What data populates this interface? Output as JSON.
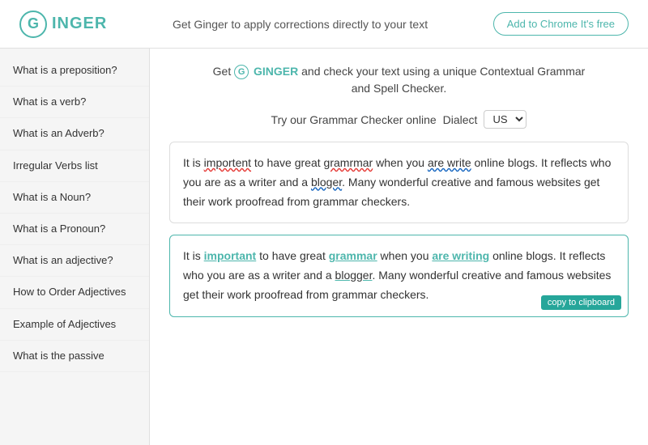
{
  "header": {
    "logo_g": "G",
    "logo_name": "INGER",
    "tagline": "Get Ginger to apply corrections directly to your text",
    "cta_button": "Add to Chrome It's free"
  },
  "sidebar": {
    "items": [
      {
        "label": "What is a preposition?"
      },
      {
        "label": "What is a verb?"
      },
      {
        "label": "What is an Adverb?"
      },
      {
        "label": "Irregular Verbs list"
      },
      {
        "label": "What is a Noun?"
      },
      {
        "label": "What is a Pronoun?"
      },
      {
        "label": "What is an adjective?"
      },
      {
        "label": "How to Order Adjectives"
      },
      {
        "label": "Example of Adjectives"
      },
      {
        "label": "What is the passive"
      }
    ]
  },
  "content": {
    "promo_text_1": "Get",
    "promo_brand": "GINGER",
    "promo_text_2": "and check your text using a unique Contextual Grammar",
    "promo_text_3": "and Spell Checker.",
    "grammar_checker_label": "Try our Grammar Checker online",
    "dialect_label": "Dialect",
    "dialect_value": "US",
    "original_box": {
      "text_pre": "It is ",
      "error1": "importent",
      "text_mid1": " to have great ",
      "error2": "gramrmar",
      "text_mid2": " when you ",
      "error3": "are write",
      "text_mid3": " online blogs. It reflects who you are as a writer and a ",
      "error4": "bloger",
      "text_end": ". Many wonderful creative and famous websites get their work proofread from grammar checkers."
    },
    "corrected_box": {
      "text_pre": "It is ",
      "word1": "important",
      "text_mid1": " to have great ",
      "word2": "grammar",
      "text_mid2": " when you ",
      "word3": "are writing",
      "text_mid3": " online blogs. It reflects who you are as a writer and a ",
      "word4": "blogger",
      "text_end": ". Many wonderful creative and famous websites get their work proofread from grammar checkers.",
      "copy_btn": "copy to clipboard"
    }
  }
}
